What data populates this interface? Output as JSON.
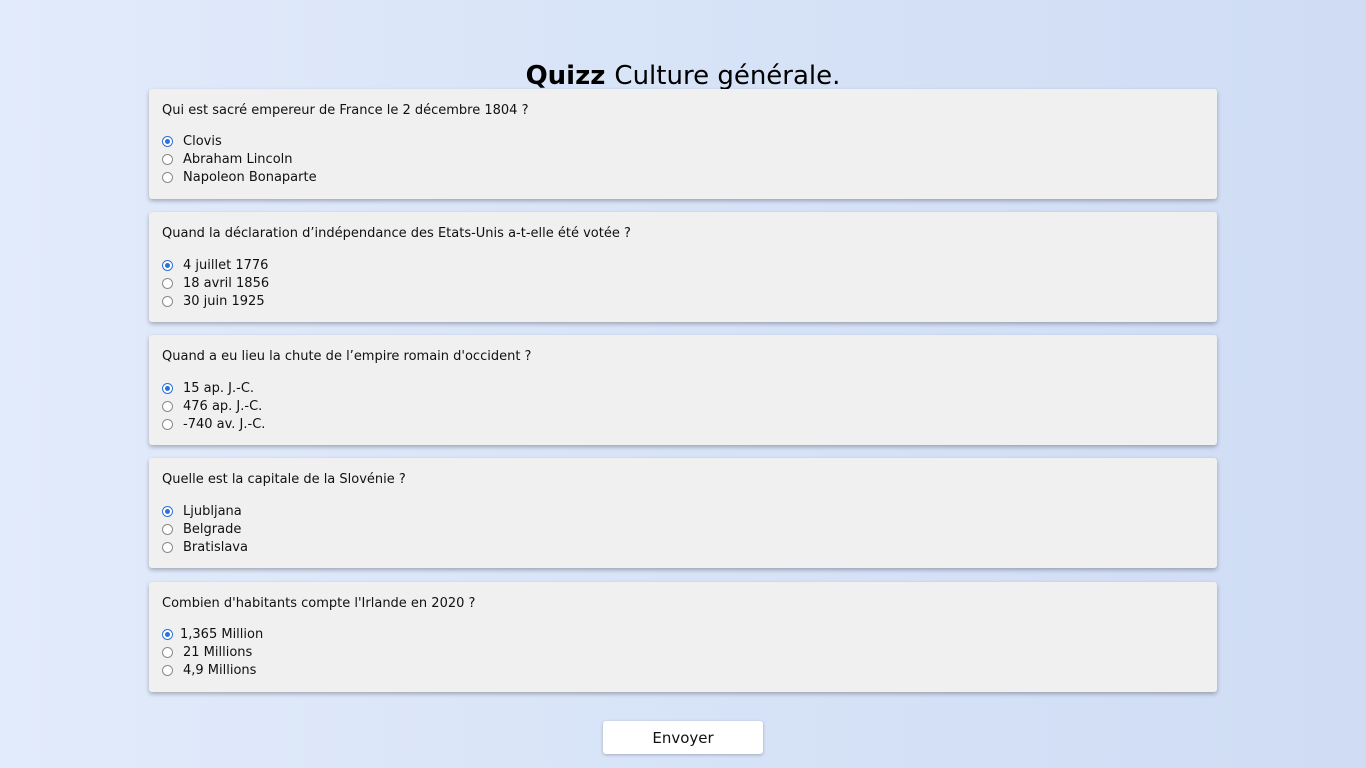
{
  "title": {
    "strong": "Quizz",
    "rest": "Culture générale."
  },
  "questions": [
    {
      "text": "Qui est sacré empereur de France le 2 décembre 1804 ?",
      "options": [
        {
          "label": "Clovis",
          "checked": true
        },
        {
          "label": "Abraham Lincoln",
          "checked": false
        },
        {
          "label": "Napoleon Bonaparte",
          "checked": false
        }
      ]
    },
    {
      "text": "Quand la déclaration d’indépendance des Etats-Unis a-t-elle été votée ?",
      "options": [
        {
          "label": "4 juillet 1776",
          "checked": true
        },
        {
          "label": "18 avril 1856",
          "checked": false
        },
        {
          "label": "30 juin 1925",
          "checked": false
        }
      ]
    },
    {
      "text": "Quand a eu lieu la chute de l’empire romain d'occident ?",
      "options": [
        {
          "label": "15 ap. J.-C.",
          "checked": true
        },
        {
          "label": "476 ap. J.-C.",
          "checked": false
        },
        {
          "label": "-740 av. J.-C.",
          "checked": false
        }
      ]
    },
    {
      "text": "Quelle est la capitale de la Slovénie ?",
      "options": [
        {
          "label": "Ljubljana",
          "checked": true
        },
        {
          "label": "Belgrade",
          "checked": false
        },
        {
          "label": "Bratislava",
          "checked": false
        }
      ]
    },
    {
      "text": "Combien d'habitants compte l'Irlande en 2020 ?",
      "options": [
        {
          "label": "1,365 Million",
          "checked": true
        },
        {
          "label": "21 Millions",
          "checked": false
        },
        {
          "label": "4,9 Millions",
          "checked": false
        }
      ]
    }
  ],
  "submit_label": "Envoyer",
  "colors": {
    "radio_checked": "#2b72d6",
    "card_background": "#f0f0f0"
  }
}
